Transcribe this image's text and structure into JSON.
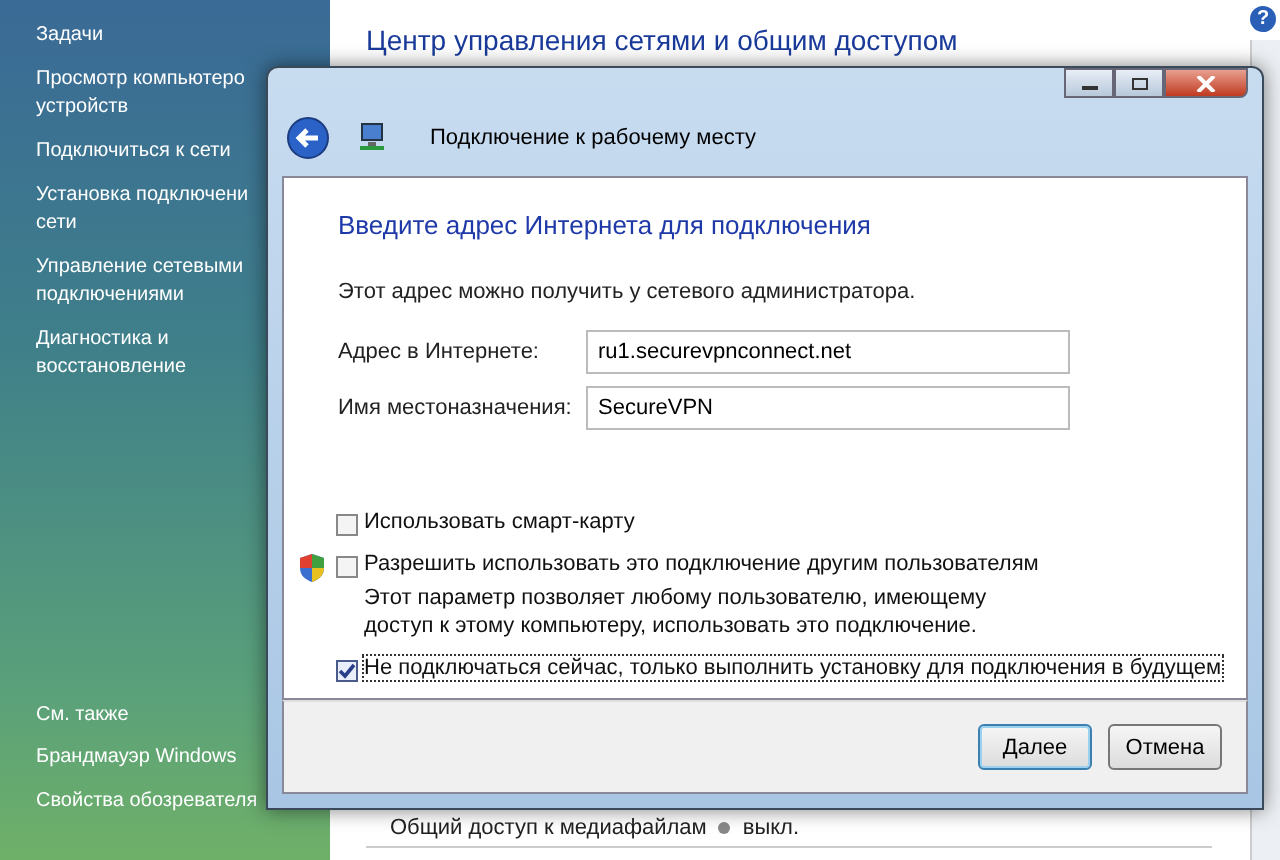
{
  "background_window": {
    "title": "Центр управления сетями и общим доступом",
    "sidebar": {
      "heading": "Задачи",
      "items": [
        {
          "lines": [
            "Просмотр компьютеро",
            "устройств"
          ]
        },
        {
          "lines": [
            "Подключиться к сети"
          ]
        },
        {
          "lines": [
            "Установка подключени",
            "сети"
          ]
        },
        {
          "lines": [
            "Управление сетевыми",
            "подключениями"
          ]
        },
        {
          "lines": [
            "Диагностика и",
            "восстановление"
          ]
        }
      ],
      "see_also": {
        "heading": "См. также",
        "items": [
          "Брандмауэр Windows",
          "Свойства обозревателя"
        ]
      }
    },
    "bottom_row": {
      "label": "Общий доступ к медиафайлам",
      "status": "выкл."
    },
    "help": "?"
  },
  "dialog": {
    "title": "Подключение к рабочему месту",
    "heading": "Введите адрес Интернета для подключения",
    "description": "Этот адрес можно получить у сетевого администратора.",
    "fields": [
      {
        "label": "Адрес в Интернете:",
        "value": "ru1.securevpnconnect.net"
      },
      {
        "label": "Имя местоназначения:",
        "value": "SecureVPN"
      }
    ],
    "options": [
      {
        "label": "Использовать смарт-карту",
        "checked": false,
        "shield": false
      },
      {
        "label": "Разрешить использовать это подключение другим пользователям",
        "checked": false,
        "shield": true,
        "note": "Этот параметр позволяет любому пользователю, имеющему доступ к этому компьютеру, использовать это подключение."
      },
      {
        "label": "Не подключаться сейчас, только выполнить установку для подключения в будущем",
        "checked": true,
        "shield": false
      }
    ],
    "buttons": [
      {
        "label": "Далее",
        "default": true
      },
      {
        "label": "Отмена",
        "default": false
      }
    ]
  }
}
